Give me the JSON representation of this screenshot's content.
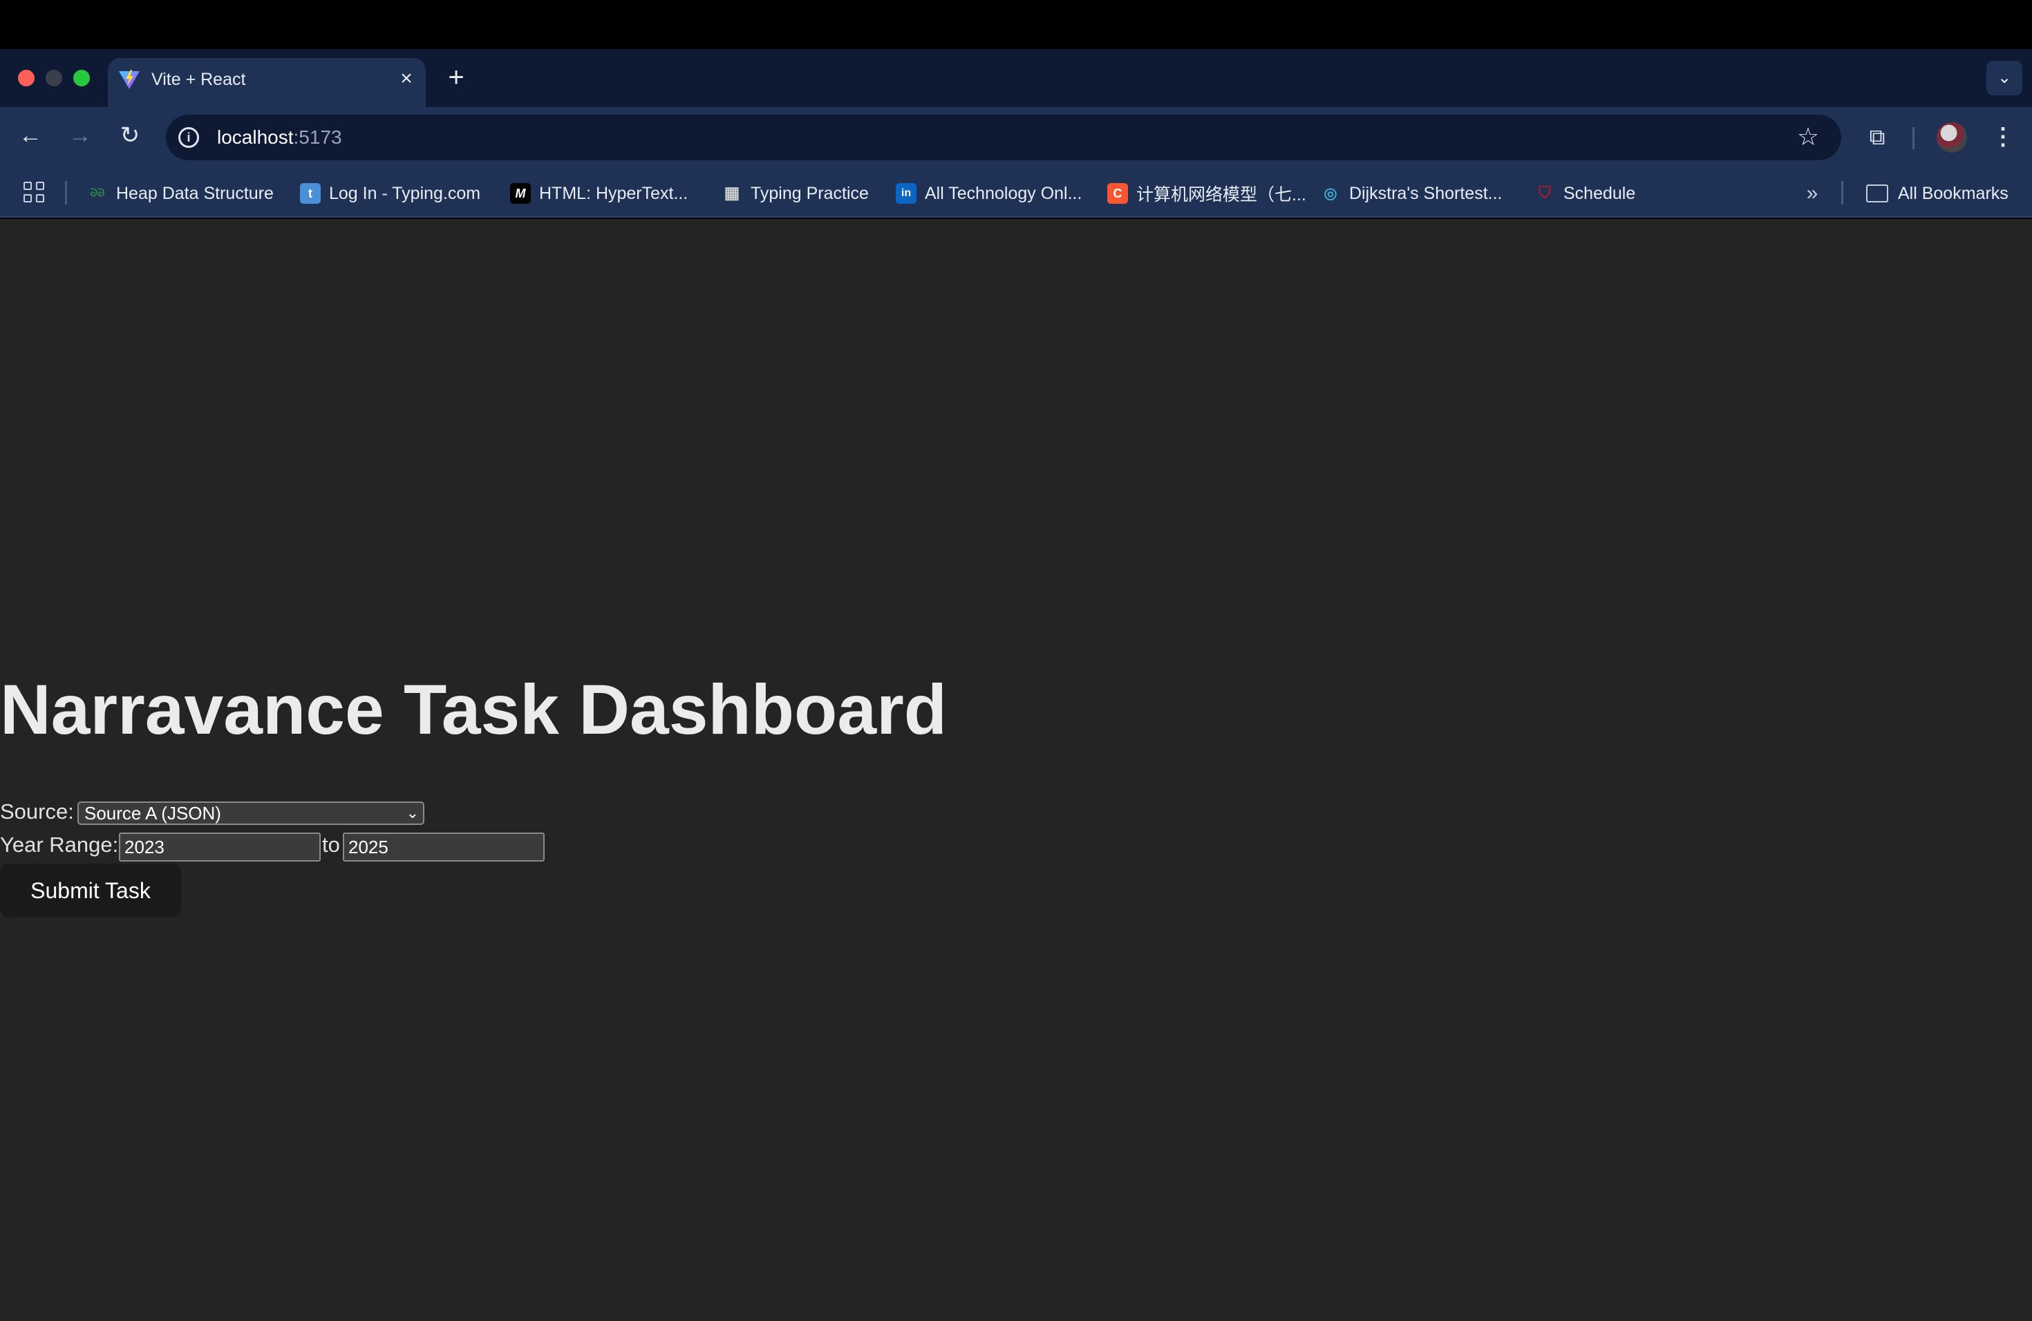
{
  "browser": {
    "tab": {
      "title": "Vite + React",
      "favicon": "vite-logo-icon",
      "close_glyph": "×"
    },
    "new_tab_glyph": "+",
    "url": {
      "host": "localhost",
      "port": ":5173"
    },
    "bookmarks": [
      {
        "label": "Heap Data Structure",
        "icon": "geeksforgeeks-icon",
        "glyph": "ᘐᘐ",
        "color": "#2f8d46"
      },
      {
        "label": "Log In - Typing.com",
        "icon": "typing-com-icon",
        "glyph": "t",
        "color": "#4a90d9"
      },
      {
        "label": "HTML: HyperText...",
        "icon": "mdn-icon",
        "glyph": "M",
        "color": "#000000"
      },
      {
        "label": "Typing Practice",
        "icon": "keyboard-icon",
        "glyph": "▦",
        "color": "#cccccc"
      },
      {
        "label": "All Technology Onl...",
        "icon": "linkedin-icon",
        "glyph": "in",
        "color": "#0a66c2"
      },
      {
        "label": "计算机网络模型（七...",
        "icon": "csdn-icon",
        "glyph": "C",
        "color": "#fc5531"
      },
      {
        "label": "Dijkstra's Shortest...",
        "icon": "eye-icon",
        "glyph": "◎",
        "color": "#3aa6c9"
      },
      {
        "label": "Schedule",
        "icon": "university-shield-icon",
        "glyph": "⛉",
        "color": "#a6192e"
      }
    ],
    "all_bookmarks_label": "All Bookmarks"
  },
  "page": {
    "title": "Narravance Task Dashboard",
    "source_label": "Source:",
    "source_selected": "Source A (JSON)",
    "year_range_label": "Year Range:",
    "year_from": "2023",
    "year_to_label": "to",
    "year_to": "2025",
    "submit_label": "Submit Task"
  }
}
